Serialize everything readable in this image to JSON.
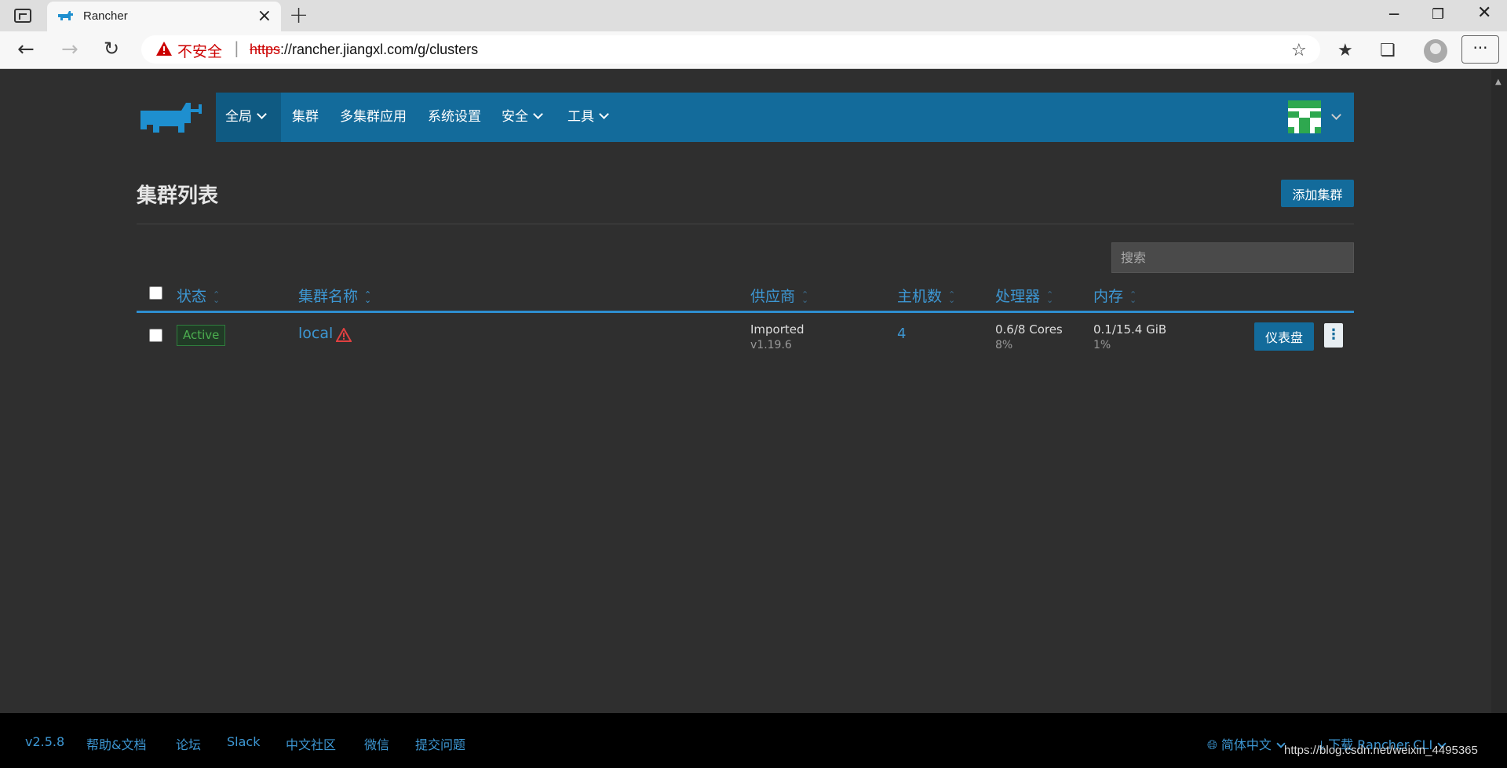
{
  "browser": {
    "tab_title": "Rancher",
    "insecure_label": "不安全",
    "url_scheme": "https",
    "url_rest": "://rancher.jiangxl.com/g/clusters"
  },
  "nav": {
    "items": [
      {
        "label": "全局",
        "dropdown": true,
        "active": true
      },
      {
        "label": "集群",
        "dropdown": false
      },
      {
        "label": "多集群应用",
        "dropdown": false
      },
      {
        "label": "系统设置",
        "dropdown": false
      },
      {
        "label": "安全",
        "dropdown": true
      },
      {
        "label": "工具",
        "dropdown": true
      }
    ]
  },
  "page": {
    "title": "集群列表",
    "add_button": "添加集群",
    "search_placeholder": "搜索"
  },
  "table": {
    "headers": [
      "状态",
      "集群名称",
      "供应商",
      "主机数",
      "处理器",
      "内存"
    ],
    "rows": [
      {
        "status": "Active",
        "name": "local",
        "provider": "Imported",
        "provider_version": "v1.19.6",
        "hosts": "4",
        "cpu": "0.6/8 Cores",
        "cpu_pct": "8%",
        "memory": "0.1/15.4 GiB",
        "memory_pct": "1%",
        "dashboard_button": "仪表盘"
      }
    ]
  },
  "footer": {
    "version": "v2.5.8",
    "links": [
      "帮助&文档",
      "论坛",
      "Slack",
      "中文社区",
      "微信",
      "提交问题"
    ],
    "language": "简体中文",
    "download": "下载 Rancher CLI"
  },
  "watermark": "https://blog.csdn.net/weixin_4495365",
  "colors": {
    "nav_bg": "#136b9b",
    "link": "#3d97d3",
    "page_bg": "#2f2f2f",
    "active_green": "#4caf50"
  }
}
